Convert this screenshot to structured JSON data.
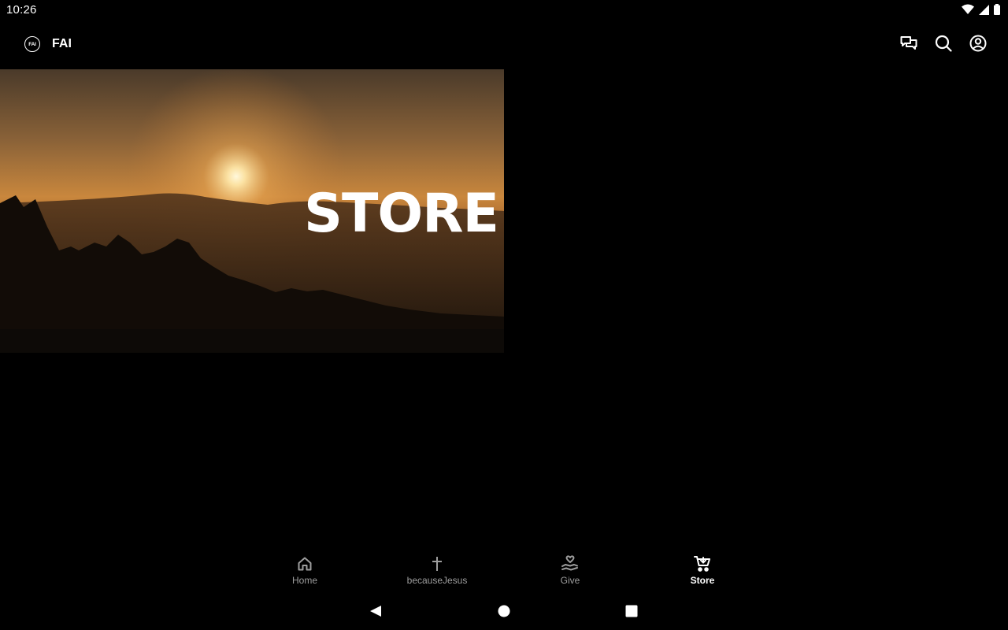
{
  "status_bar": {
    "time": "10:26"
  },
  "app_bar": {
    "logo_text": "FAI",
    "title": "FAI",
    "actions": [
      "chat-icon",
      "search-icon",
      "account-icon"
    ]
  },
  "hero": {
    "title": "STORE"
  },
  "bottom_nav": {
    "items": [
      {
        "label": "Home",
        "icon": "home-icon",
        "active": false
      },
      {
        "label": "becauseJesus",
        "icon": "cross-icon",
        "active": false
      },
      {
        "label": "Give",
        "icon": "give-hand-heart-icon",
        "active": false
      },
      {
        "label": "Store",
        "icon": "cart-icon",
        "active": true
      }
    ]
  },
  "colors": {
    "background": "#000000",
    "active": "#ffffff",
    "inactive": "#9e9e9e"
  }
}
